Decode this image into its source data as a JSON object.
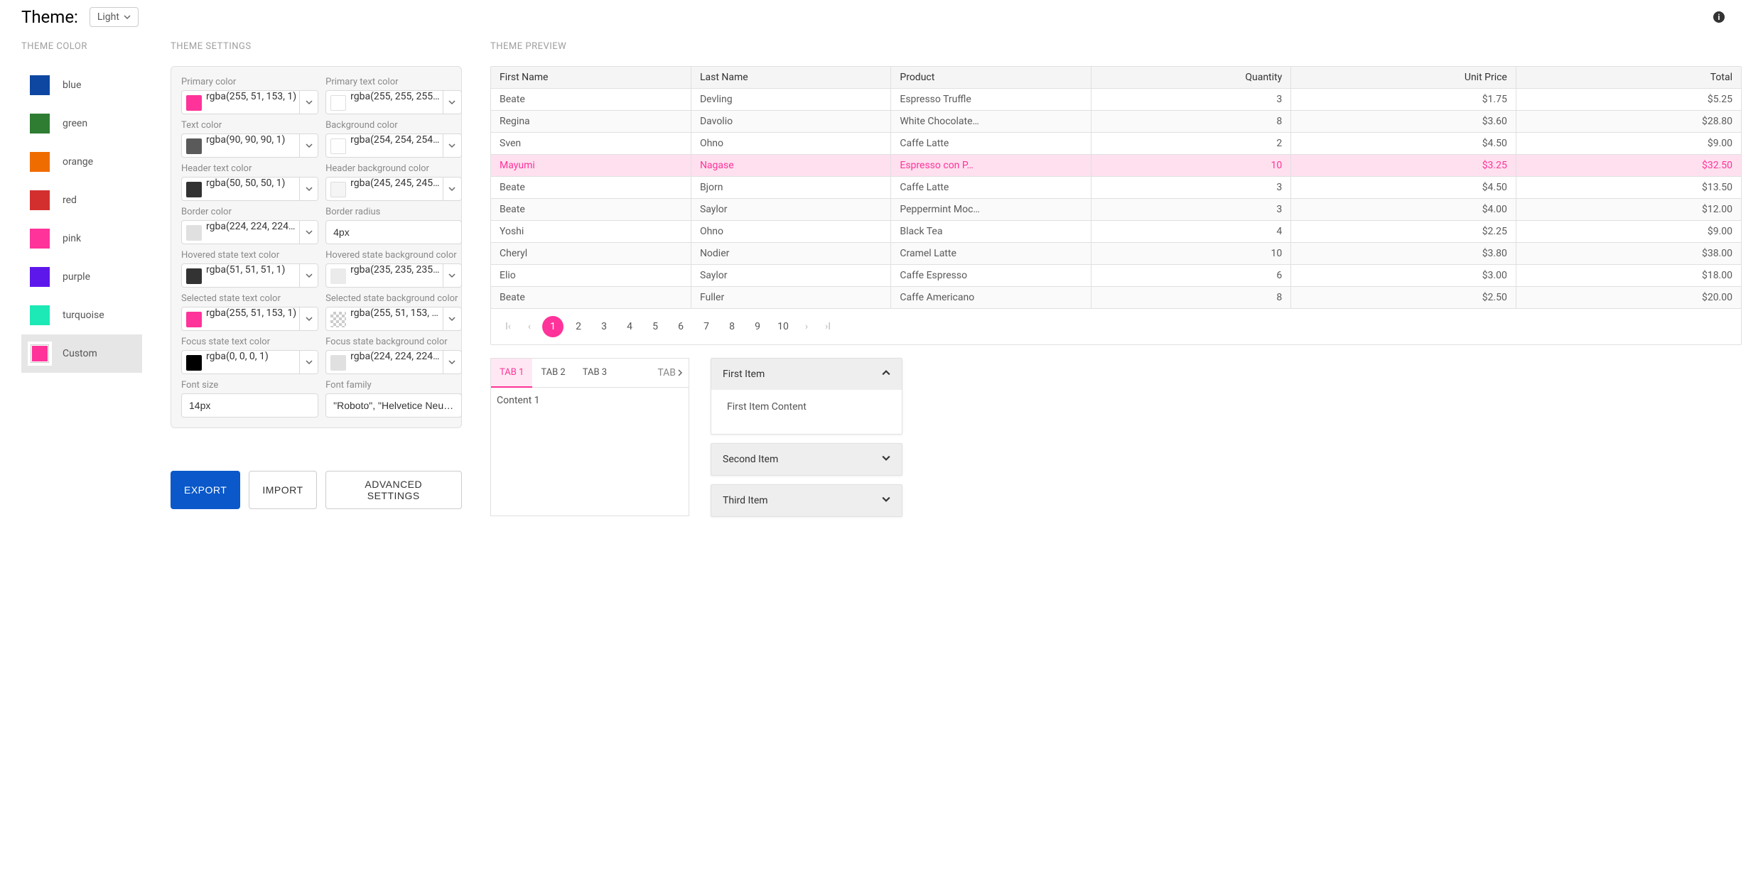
{
  "topbar": {
    "theme_label": "Theme:",
    "theme_value": "Light"
  },
  "sections": {
    "theme_color": "THEME COLOR",
    "theme_settings": "THEME SETTINGS",
    "theme_preview": "THEME PREVIEW"
  },
  "theme_colors": [
    {
      "label": "blue",
      "color": "#0d47a1"
    },
    {
      "label": "green",
      "color": "#2e7d32"
    },
    {
      "label": "orange",
      "color": "#ef6c00"
    },
    {
      "label": "red",
      "color": "#d32f2f"
    },
    {
      "label": "pink",
      "color": "#ff3399"
    },
    {
      "label": "purple",
      "color": "#5e17eb"
    },
    {
      "label": "turquoise",
      "color": "#1de9b6"
    },
    {
      "label": "Custom",
      "color": "#ff3399",
      "selected": true
    }
  ],
  "settings": [
    {
      "label": "Primary color",
      "value": "rgba(255, 51, 153, 1)",
      "swatch": "#ff3399"
    },
    {
      "label": "Primary text color",
      "value": "rgba(255, 255, 255…",
      "swatch": "#ffffff"
    },
    {
      "label": "Text color",
      "value": "rgba(90, 90, 90, 1)",
      "swatch": "#5a5a5a"
    },
    {
      "label": "Background color",
      "value": "rgba(254, 254, 254…",
      "swatch": "#fefefe"
    },
    {
      "label": "Header text color",
      "value": "rgba(50, 50, 50, 1)",
      "swatch": "#323232"
    },
    {
      "label": "Header background color",
      "value": "rgba(245, 245, 245…",
      "swatch": "#f5f5f5"
    },
    {
      "label": "Border color",
      "value": "rgba(224, 224, 224…",
      "swatch": "#e0e0e0"
    },
    {
      "label": "Border radius",
      "value": "4px",
      "plain": true
    },
    {
      "label": "Hovered state text color",
      "value": "rgba(51, 51, 51, 1)",
      "swatch": "#333333"
    },
    {
      "label": "Hovered state background color",
      "value": "rgba(235, 235, 235…",
      "swatch": "#ebebeb"
    },
    {
      "label": "Selected state text color",
      "value": "rgba(255, 51, 153, 1)",
      "swatch": "#ff3399"
    },
    {
      "label": "Selected state background color",
      "value": "rgba(255, 51, 153, …",
      "swatch": "checker"
    },
    {
      "label": "Focus state text color",
      "value": "rgba(0, 0, 0, 1)",
      "swatch": "#000000"
    },
    {
      "label": "Focus state background color",
      "value": "rgba(224, 224, 224…",
      "swatch": "#e0e0e0"
    },
    {
      "label": "Font size",
      "value": "14px",
      "plain": true
    },
    {
      "label": "Font family",
      "value": "\"Roboto\", \"Helvetice Neue\", sa",
      "plain": true
    }
  ],
  "buttons": {
    "export": "EXPORT",
    "import": "IMPORT",
    "advanced": "ADVANCED SETTINGS"
  },
  "table": {
    "headers": [
      "First Name",
      "Last Name",
      "Product",
      "Quantity",
      "Unit Price",
      "Total"
    ],
    "rows": [
      {
        "first": "Beate",
        "last": "Devling",
        "product": "Espresso Truffle",
        "qty": "3",
        "unit": "$1.75",
        "total": "$5.25"
      },
      {
        "first": "Regina",
        "last": "Davolio",
        "product": "White Chocolate…",
        "qty": "8",
        "unit": "$3.60",
        "total": "$28.80"
      },
      {
        "first": "Sven",
        "last": "Ohno",
        "product": "Caffe Latte",
        "qty": "2",
        "unit": "$4.50",
        "total": "$9.00"
      },
      {
        "first": "Mayumi",
        "last": "Nagase",
        "product": "Espresso con P…",
        "qty": "10",
        "unit": "$3.25",
        "total": "$32.50",
        "selected": true
      },
      {
        "first": "Beate",
        "last": "Bjorn",
        "product": "Caffe Latte",
        "qty": "3",
        "unit": "$4.50",
        "total": "$13.50"
      },
      {
        "first": "Beate",
        "last": "Saylor",
        "product": "Peppermint Moc…",
        "qty": "3",
        "unit": "$4.00",
        "total": "$12.00"
      },
      {
        "first": "Yoshi",
        "last": "Ohno",
        "product": "Black Tea",
        "qty": "4",
        "unit": "$2.25",
        "total": "$9.00"
      },
      {
        "first": "Cheryl",
        "last": "Nodier",
        "product": "Cramel Latte",
        "qty": "10",
        "unit": "$3.80",
        "total": "$38.00"
      },
      {
        "first": "Elio",
        "last": "Saylor",
        "product": "Caffe Espresso",
        "qty": "6",
        "unit": "$3.00",
        "total": "$18.00"
      },
      {
        "first": "Beate",
        "last": "Fuller",
        "product": "Caffe Americano",
        "qty": "8",
        "unit": "$2.50",
        "total": "$20.00"
      }
    ]
  },
  "pager": {
    "pages": [
      "1",
      "2",
      "3",
      "4",
      "5",
      "6",
      "7",
      "8",
      "9",
      "10"
    ],
    "active": 0
  },
  "tabs": {
    "items": [
      "TAB 1",
      "TAB 2",
      "TAB 3"
    ],
    "overflow": "TAB",
    "active": 0,
    "content": "Content 1"
  },
  "accordion": [
    {
      "title": "First Item",
      "content": "First Item Content",
      "open": true
    },
    {
      "title": "Second Item",
      "open": false
    },
    {
      "title": "Third Item",
      "open": false
    }
  ]
}
